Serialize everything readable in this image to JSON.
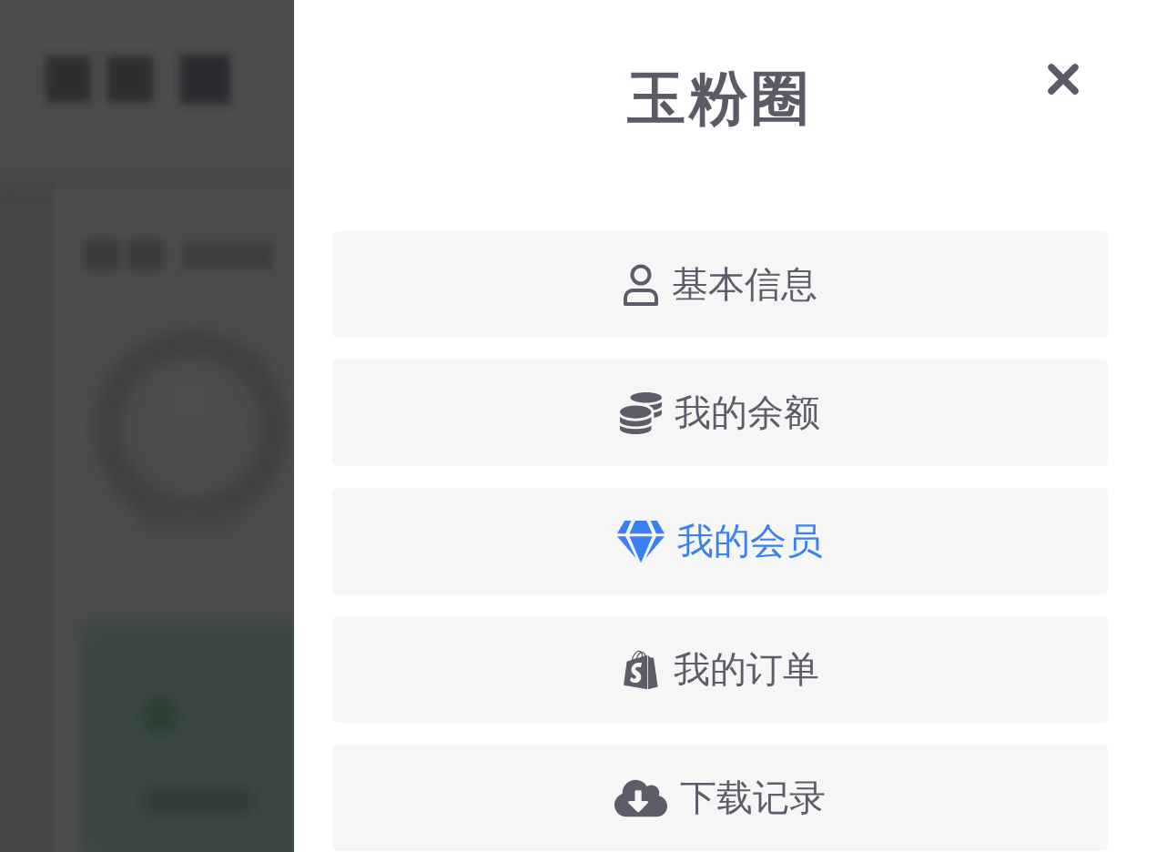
{
  "drawer": {
    "title": "玉粉圈"
  },
  "menu": [
    {
      "kind": "user",
      "label": "基本信息",
      "selected": false
    },
    {
      "kind": "coins",
      "label": "我的余额",
      "selected": false
    },
    {
      "kind": "gem",
      "label": "我的会员",
      "selected": true
    },
    {
      "kind": "bag",
      "label": "我的订单",
      "selected": false
    },
    {
      "kind": "cloud-download",
      "label": "下载记录",
      "selected": false
    }
  ]
}
